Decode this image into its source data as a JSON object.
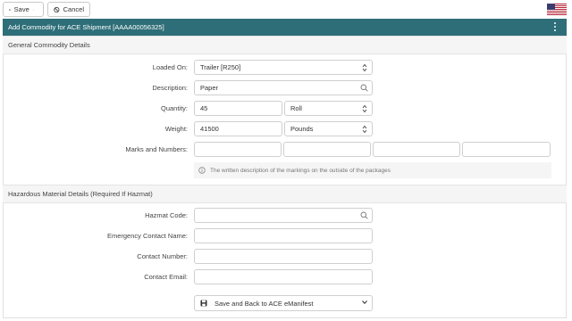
{
  "toolbar": {
    "save_label": "Save",
    "cancel_label": "Cancel"
  },
  "header": {
    "title": "Add Commodity for ACE Shipment [AAAA00056325]"
  },
  "general": {
    "heading": "General Commodity Details",
    "loaded_on": {
      "label": "Loaded On:",
      "value": "Trailer [R250]"
    },
    "description": {
      "label": "Description:",
      "value": "Paper"
    },
    "quantity": {
      "label": "Quantity:",
      "value": "45",
      "unit": "Roll"
    },
    "weight": {
      "label": "Weight:",
      "value": "41500",
      "unit": "Pounds"
    },
    "marks": {
      "label": "Marks and Numbers:",
      "values": [
        "",
        "",
        "",
        ""
      ],
      "hint": "The written description of the markings on the outside of the packages"
    }
  },
  "hazmat": {
    "heading": "Hazardous Material Details (Required If Hazmat)",
    "code": {
      "label": "Hazmat Code:",
      "value": ""
    },
    "contact_name": {
      "label": "Emergency Contact Name:",
      "value": ""
    },
    "contact_number": {
      "label": "Contact Number:",
      "value": ""
    },
    "contact_email": {
      "label": "Contact Email:",
      "value": ""
    }
  },
  "actions": {
    "submit_label": "Save and Back to ACE eManifest"
  },
  "colors": {
    "header_bg": "#2e6e78",
    "section_bg": "#f5f5f5"
  },
  "icons": [
    "floppy-disk-icon",
    "chevron-down-icon",
    "ban-icon",
    "us-flag-icon",
    "kebab-menu-icon",
    "search-icon",
    "sort-arrows-icon",
    "info-circle-icon"
  ]
}
